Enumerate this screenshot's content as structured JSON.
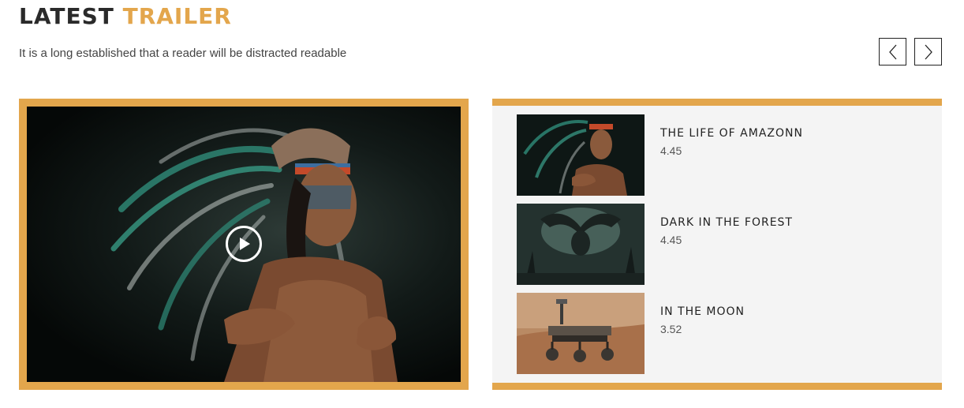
{
  "header": {
    "title_part1": "LATEST",
    "title_part2": "TRAILER",
    "subtitle": "It is a long established that a reader will be distracted readable"
  },
  "nav": {
    "prev_icon": "chevron-left-icon",
    "next_icon": "chevron-right-icon"
  },
  "player": {
    "play_icon": "play-icon"
  },
  "playlist": {
    "items": [
      {
        "title": "THE LIFE OF AMAZONN",
        "rating": "4.45"
      },
      {
        "title": "DARK IN THE FOREST",
        "rating": "4.45"
      },
      {
        "title": "IN THE MOON",
        "rating": "3.52"
      }
    ]
  },
  "colors": {
    "accent": "#e3a64c",
    "dark_text": "#2a2a2a",
    "panel_bg": "#f4f4f4"
  }
}
